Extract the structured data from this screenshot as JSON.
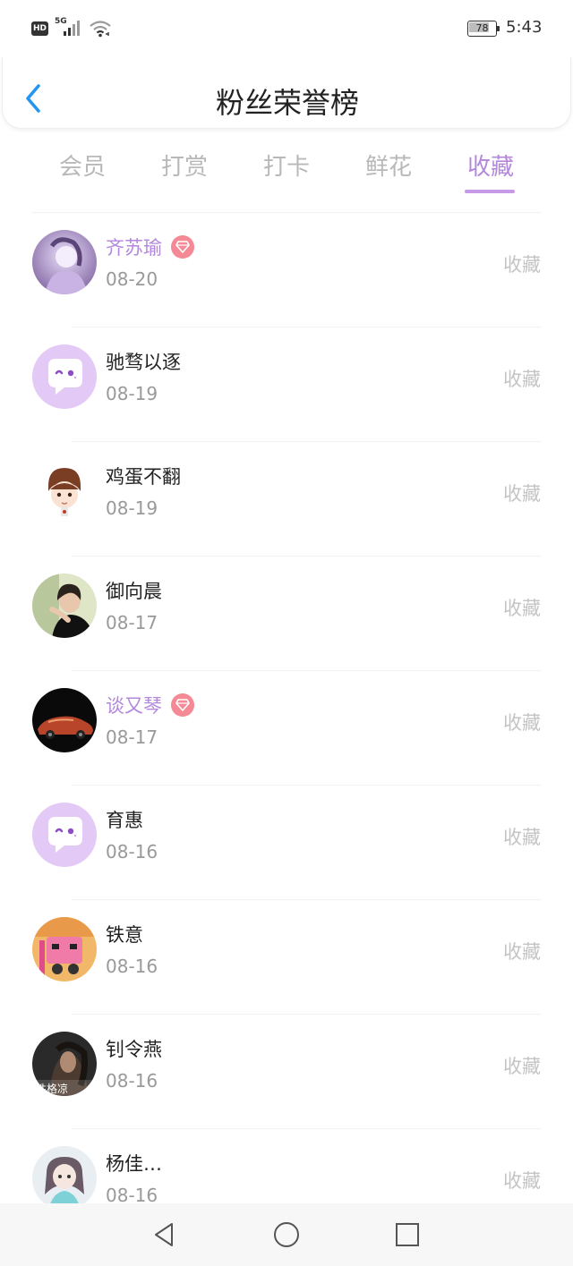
{
  "status_bar": {
    "hd_label": "HD",
    "signal_label": "5G",
    "battery": "78",
    "time": "5:43"
  },
  "header": {
    "title": "粉丝荣誉榜",
    "back_icon": "chevron-left-icon"
  },
  "tabs": [
    {
      "label": "会员",
      "active": false
    },
    {
      "label": "打赏",
      "active": false
    },
    {
      "label": "打卡",
      "active": false
    },
    {
      "label": "鲜花",
      "active": false
    },
    {
      "label": "收藏",
      "active": true
    }
  ],
  "colors": {
    "accent": "#b387dc",
    "vip_gem": "#f58a96",
    "muted": "#999999",
    "action": "#c4c4c4"
  },
  "fans": [
    {
      "name": "齐苏瑜",
      "date": "08-20",
      "action": "收藏",
      "vip": true
    },
    {
      "name": "驰骛以逐",
      "date": "08-19",
      "action": "收藏",
      "vip": false
    },
    {
      "name": "鸡蛋不翻",
      "date": "08-19",
      "action": "收藏",
      "vip": false
    },
    {
      "name": "御向晨",
      "date": "08-17",
      "action": "收藏",
      "vip": false
    },
    {
      "name": "谈又琴",
      "date": "08-17",
      "action": "收藏",
      "vip": true
    },
    {
      "name": "育惠",
      "date": "08-16",
      "action": "收藏",
      "vip": false
    },
    {
      "name": "铁意",
      "date": "08-16",
      "action": "收藏",
      "vip": false
    },
    {
      "name": "钊令燕",
      "date": "08-16",
      "action": "收藏",
      "vip": false
    },
    {
      "name": "杨佳…",
      "date": "08-16",
      "action": "收藏",
      "vip": false
    }
  ],
  "avatar_texts": {
    "row8": "性格凉"
  },
  "nav_bar": {
    "back": "triangle-back-icon",
    "home": "circle-home-icon",
    "recents": "square-recents-icon"
  }
}
